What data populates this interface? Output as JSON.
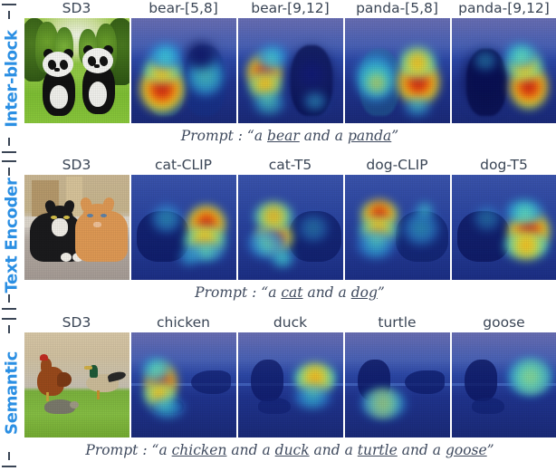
{
  "figure": {
    "title": "attention heatmap comparison grid",
    "accent_color": "#2b8fe3",
    "text_color": "#3a4555"
  },
  "rows": [
    {
      "axis_label": "Inter-block",
      "headers": [
        "SD3",
        "bear-[5,8]",
        "bear-[9,12]",
        "panda-[5,8]",
        "panda-[9,12]"
      ],
      "prompt_prefix": "Prompt :",
      "prompt_open_quote": "“",
      "prompt_close_quote": "”",
      "prompt_parts": [
        {
          "text": "a ",
          "underline": false
        },
        {
          "text": "bear",
          "underline": true
        },
        {
          "text": " and a ",
          "underline": false
        },
        {
          "text": "panda",
          "underline": true
        }
      ],
      "prompt_plain": "Prompt : “a bear and a panda”",
      "subject": "two pandas standing in a green bamboo forest"
    },
    {
      "axis_label": "Text Encoder",
      "headers": [
        "SD3",
        "cat-CLIP",
        "cat-T5",
        "dog-CLIP",
        "dog-T5"
      ],
      "prompt_prefix": "Prompt :",
      "prompt_open_quote": "“",
      "prompt_close_quote": "”",
      "prompt_parts": [
        {
          "text": "a ",
          "underline": false
        },
        {
          "text": "cat",
          "underline": true
        },
        {
          "text": " and a ",
          "underline": false
        },
        {
          "text": "dog",
          "underline": true
        }
      ],
      "prompt_plain": "Prompt : “a cat and a dog”",
      "subject": "a black-and-white cat and an orange cat lying side by side"
    },
    {
      "axis_label": "Semantic",
      "headers": [
        "SD3",
        "chicken",
        "duck",
        "turtle",
        "goose"
      ],
      "prompt_prefix": "Prompt :",
      "prompt_open_quote": "“",
      "prompt_close_quote": "”",
      "prompt_parts": [
        {
          "text": "a ",
          "underline": false
        },
        {
          "text": "chicken",
          "underline": true
        },
        {
          "text": " and a ",
          "underline": false
        },
        {
          "text": "duck",
          "underline": true
        },
        {
          "text": " and a ",
          "underline": false
        },
        {
          "text": "turtle",
          "underline": true
        },
        {
          "text": " and a ",
          "underline": false
        },
        {
          "text": "goose",
          "underline": true
        }
      ],
      "prompt_plain": "Prompt : “a chicken and a duck and a turtle and a goose”",
      "subject": "a hen, a mallard duck and a turtle beside a lake"
    }
  ]
}
